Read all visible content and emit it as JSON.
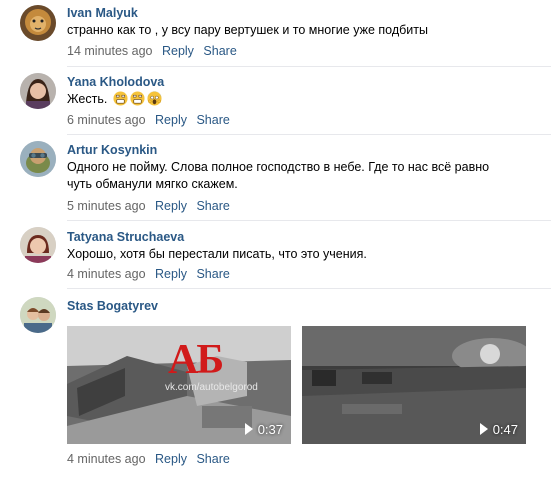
{
  "comments": [
    {
      "author": "Ivan Malyuk",
      "text": "странно как то , у всу пару вертушек и то многие уже подбиты",
      "time": "14 minutes ago",
      "reply": "Reply",
      "share": "Share"
    },
    {
      "author": "Yana Kholodova",
      "text": "Жесть.",
      "emojis": [
        "face-screaming-emoji",
        "face-screaming-emoji",
        "face-screaming-in-fear-emoji"
      ],
      "time": "6 minutes ago",
      "reply": "Reply",
      "share": "Share"
    },
    {
      "author": "Artur Kosynkin",
      "text_line1": "Одного не пойму. Слова полное господство в небе. Где то нас всё равно",
      "text_line2": "чуть обманули мягко скажем.",
      "time": "5 minutes ago",
      "reply": "Reply",
      "share": "Share"
    },
    {
      "author": "Tatyana Struchaeva",
      "text": "Хорошо, хотя бы перестали писать, что это учения.",
      "time": "4 minutes ago",
      "reply": "Reply",
      "share": "Share"
    },
    {
      "author": "Stas Bogatyrev",
      "videos": [
        {
          "duration": "0:37",
          "watermark": "АБ",
          "watermark_url": "vk.com/autobelgorod"
        },
        {
          "duration": "0:47"
        }
      ],
      "time": "4 minutes ago",
      "reply": "Reply",
      "share": "Share"
    }
  ],
  "colors": {
    "author": "#2a5885",
    "meta": "#656565",
    "separator": "#e7e8ec",
    "watermark": "#d11a1a"
  }
}
